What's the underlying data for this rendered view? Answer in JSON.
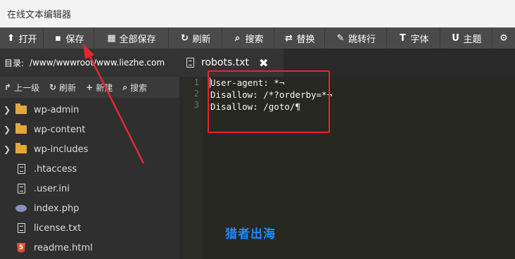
{
  "window": {
    "title": "在线文本编辑器"
  },
  "toolbar": {
    "items": [
      {
        "label": "打开",
        "icon": "upload-icon",
        "glyph": "⬆"
      },
      {
        "label": "保存",
        "icon": "save-icon",
        "glyph": "▪"
      },
      {
        "label": "全部保存",
        "icon": "save-all-icon",
        "glyph": "▦"
      },
      {
        "label": "刷新",
        "icon": "refresh-icon",
        "glyph": "↻"
      },
      {
        "label": "搜索",
        "icon": "search-icon",
        "glyph": "⌕"
      },
      {
        "label": "替换",
        "icon": "replace-icon",
        "glyph": "⇄"
      },
      {
        "label": "跳转行",
        "icon": "pin-icon",
        "glyph": "✎"
      },
      {
        "label": "字体",
        "icon": "font-icon",
        "glyph": "T"
      },
      {
        "label": "主题",
        "icon": "magnet-icon",
        "glyph": "U"
      },
      {
        "label": "",
        "icon": "gear-icon",
        "glyph": "⚙"
      }
    ]
  },
  "sidebar": {
    "path_label": "目录:",
    "path_value": "/www/wwwroot/www.liezhe.com",
    "actions": [
      {
        "label": "上一级",
        "icon": "up-level-icon",
        "glyph": "↱"
      },
      {
        "label": "刷新",
        "icon": "refresh-icon",
        "glyph": "↻"
      },
      {
        "label": "新建",
        "icon": "new-icon",
        "glyph": "+"
      },
      {
        "label": "搜索",
        "icon": "search-icon",
        "glyph": "⌕"
      }
    ],
    "files": [
      {
        "name": "wp-admin",
        "type": "folder"
      },
      {
        "name": "wp-content",
        "type": "folder"
      },
      {
        "name": "wp-includes",
        "type": "folder"
      },
      {
        "name": ".htaccess",
        "type": "file"
      },
      {
        "name": ".user.ini",
        "type": "file"
      },
      {
        "name": "index.php",
        "type": "php"
      },
      {
        "name": "license.txt",
        "type": "file"
      },
      {
        "name": "readme.html",
        "type": "html"
      }
    ]
  },
  "editor": {
    "tab": {
      "filename": "robots.txt",
      "close_glyph": "✖"
    },
    "line_numbers": [
      "1",
      "2",
      "3"
    ],
    "lines": [
      "User-agent: *¬",
      "Disallow: /*?orderby=*¬",
      "Disallow: /goto/¶"
    ],
    "watermark": "猎者出海"
  },
  "colors": {
    "toolbar_bg": "#4a4a4a",
    "editor_bg": "#272822",
    "annotation_red": "#e5262a",
    "watermark_blue": "#1e8bff"
  }
}
